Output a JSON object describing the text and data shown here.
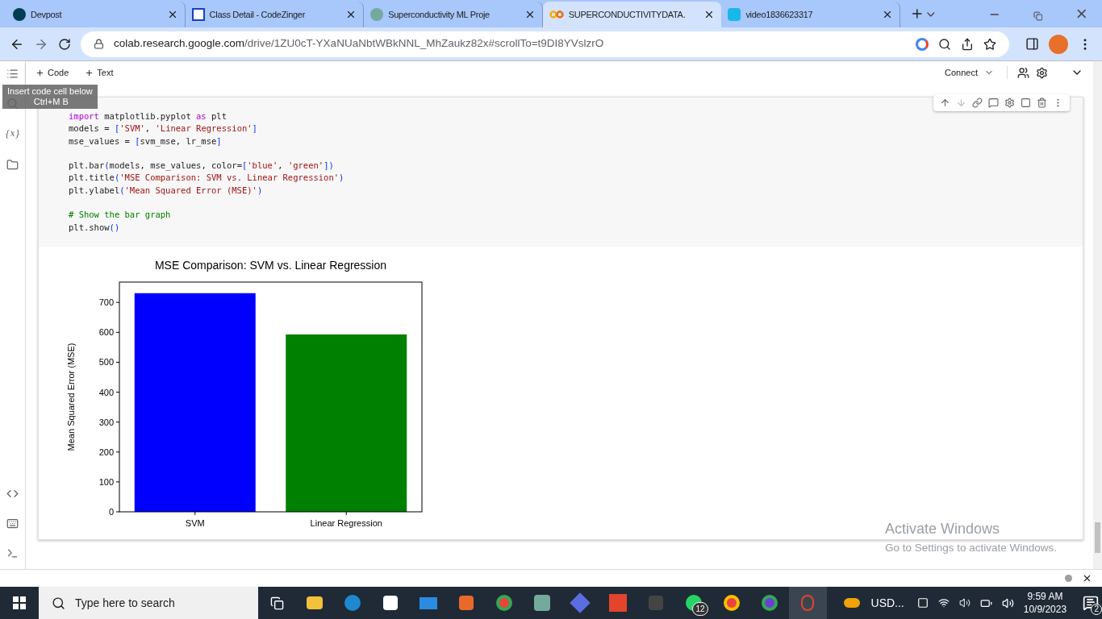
{
  "tabs": [
    {
      "label": "Devpost",
      "selected": false
    },
    {
      "label": "Class Detail - CodeZinger",
      "selected": false
    },
    {
      "label": "Superconductivity ML Proje",
      "selected": false
    },
    {
      "label": "SUPERCONDUCTIVITYDATA.",
      "selected": true
    },
    {
      "label": "video1836623317",
      "selected": false
    }
  ],
  "address": {
    "host": "colab.research.google.com",
    "path": "/drive/1ZU0cT-YXaNUaNbtWBkNNL_MhZaukz82x#scrollTo=t9DI8YVslzrO"
  },
  "sidebar": {
    "variables_label": "{x}"
  },
  "toolbar": {
    "add_code": "Code",
    "add_text": "Text",
    "connect": "Connect"
  },
  "tooltip": {
    "title": "Insert code cell below",
    "shortcut": "Ctrl+M B"
  },
  "code_blocks": [
    [
      [
        {
          "kind": "keyword",
          "text": "import"
        },
        {
          "kind": "plain",
          "text": " matplotlib.pyplot "
        },
        {
          "kind": "keyword",
          "text": "as"
        },
        {
          "kind": "plain",
          "text": " plt"
        }
      ],
      [
        {
          "kind": "plain",
          "text": "models = "
        },
        {
          "kind": "bracket",
          "text": "["
        },
        {
          "kind": "string",
          "text": "'SVM'"
        },
        {
          "kind": "plain",
          "text": ", "
        },
        {
          "kind": "string",
          "text": "'Linear Regression'"
        },
        {
          "kind": "bracket",
          "text": "]"
        }
      ],
      [
        {
          "kind": "plain",
          "text": "mse_values = "
        },
        {
          "kind": "bracket",
          "text": "["
        },
        {
          "kind": "plain",
          "text": "svm_mse, lr_mse"
        },
        {
          "kind": "bracket",
          "text": "]"
        }
      ]
    ],
    [
      [
        {
          "kind": "plain",
          "text": "plt.bar"
        },
        {
          "kind": "bracket",
          "text": "("
        },
        {
          "kind": "plain",
          "text": "models, mse_values, color="
        },
        {
          "kind": "bracket",
          "text": "["
        },
        {
          "kind": "string",
          "text": "'blue'"
        },
        {
          "kind": "plain",
          "text": ", "
        },
        {
          "kind": "string",
          "text": "'green'"
        },
        {
          "kind": "bracket",
          "text": "])"
        }
      ],
      [
        {
          "kind": "plain",
          "text": "plt.title"
        },
        {
          "kind": "bracket",
          "text": "("
        },
        {
          "kind": "string",
          "text": "'MSE Comparison: SVM vs. Linear Regression'"
        },
        {
          "kind": "bracket",
          "text": ")"
        }
      ],
      [
        {
          "kind": "plain",
          "text": "plt.ylabel"
        },
        {
          "kind": "bracket",
          "text": "("
        },
        {
          "kind": "string",
          "text": "'Mean Squared Error (MSE)'"
        },
        {
          "kind": "bracket",
          "text": ")"
        }
      ]
    ],
    [
      [
        {
          "kind": "comment",
          "text": "# Show the bar graph"
        }
      ],
      [
        {
          "kind": "plain",
          "text": "plt.show"
        },
        {
          "kind": "bracket",
          "text": "()"
        }
      ]
    ]
  ],
  "chart_data": {
    "type": "bar",
    "title": "MSE Comparison: SVM vs. Linear Regression",
    "ylabel": "Mean Squared Error (MSE)",
    "categories": [
      "SVM",
      "Linear Regression"
    ],
    "series": [
      {
        "color": "#0000ff",
        "values": [
          731,
          null
        ]
      },
      {
        "color": "#008000",
        "values": [
          null,
          593
        ]
      }
    ],
    "ylim": [
      0,
      768
    ],
    "yticks": [
      0,
      100,
      200,
      300,
      400,
      500,
      600,
      700
    ]
  },
  "watermark": {
    "title": "Activate Windows",
    "subtitle": "Go to Settings to activate Windows."
  },
  "taskbar": {
    "search_placeholder": "Type here to search",
    "whatsapp_badge": "12",
    "tray_text": "USD...",
    "time": "9:59 AM",
    "date": "10/9/2023",
    "notifications": "2"
  }
}
